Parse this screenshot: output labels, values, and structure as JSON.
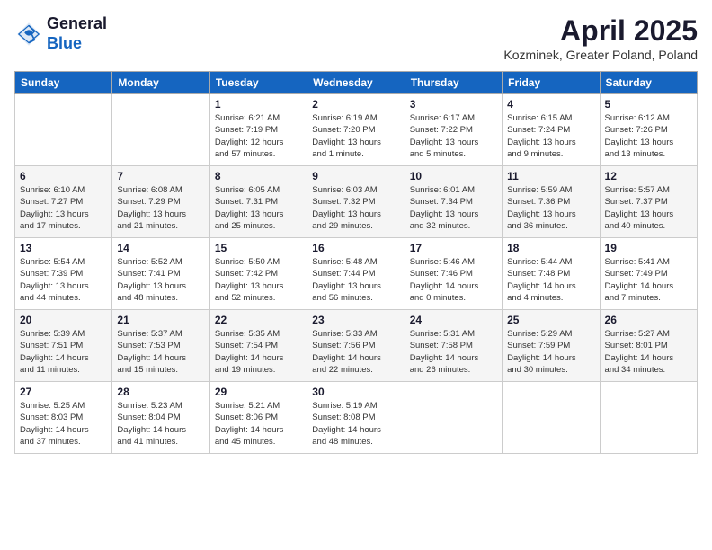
{
  "header": {
    "logo_general": "General",
    "logo_blue": "Blue",
    "month_title": "April 2025",
    "location": "Kozminek, Greater Poland, Poland"
  },
  "weekdays": [
    "Sunday",
    "Monday",
    "Tuesday",
    "Wednesday",
    "Thursday",
    "Friday",
    "Saturday"
  ],
  "weeks": [
    [
      {
        "day": "",
        "info": ""
      },
      {
        "day": "",
        "info": ""
      },
      {
        "day": "1",
        "info": "Sunrise: 6:21 AM\nSunset: 7:19 PM\nDaylight: 12 hours\nand 57 minutes."
      },
      {
        "day": "2",
        "info": "Sunrise: 6:19 AM\nSunset: 7:20 PM\nDaylight: 13 hours\nand 1 minute."
      },
      {
        "day": "3",
        "info": "Sunrise: 6:17 AM\nSunset: 7:22 PM\nDaylight: 13 hours\nand 5 minutes."
      },
      {
        "day": "4",
        "info": "Sunrise: 6:15 AM\nSunset: 7:24 PM\nDaylight: 13 hours\nand 9 minutes."
      },
      {
        "day": "5",
        "info": "Sunrise: 6:12 AM\nSunset: 7:26 PM\nDaylight: 13 hours\nand 13 minutes."
      }
    ],
    [
      {
        "day": "6",
        "info": "Sunrise: 6:10 AM\nSunset: 7:27 PM\nDaylight: 13 hours\nand 17 minutes."
      },
      {
        "day": "7",
        "info": "Sunrise: 6:08 AM\nSunset: 7:29 PM\nDaylight: 13 hours\nand 21 minutes."
      },
      {
        "day": "8",
        "info": "Sunrise: 6:05 AM\nSunset: 7:31 PM\nDaylight: 13 hours\nand 25 minutes."
      },
      {
        "day": "9",
        "info": "Sunrise: 6:03 AM\nSunset: 7:32 PM\nDaylight: 13 hours\nand 29 minutes."
      },
      {
        "day": "10",
        "info": "Sunrise: 6:01 AM\nSunset: 7:34 PM\nDaylight: 13 hours\nand 32 minutes."
      },
      {
        "day": "11",
        "info": "Sunrise: 5:59 AM\nSunset: 7:36 PM\nDaylight: 13 hours\nand 36 minutes."
      },
      {
        "day": "12",
        "info": "Sunrise: 5:57 AM\nSunset: 7:37 PM\nDaylight: 13 hours\nand 40 minutes."
      }
    ],
    [
      {
        "day": "13",
        "info": "Sunrise: 5:54 AM\nSunset: 7:39 PM\nDaylight: 13 hours\nand 44 minutes."
      },
      {
        "day": "14",
        "info": "Sunrise: 5:52 AM\nSunset: 7:41 PM\nDaylight: 13 hours\nand 48 minutes."
      },
      {
        "day": "15",
        "info": "Sunrise: 5:50 AM\nSunset: 7:42 PM\nDaylight: 13 hours\nand 52 minutes."
      },
      {
        "day": "16",
        "info": "Sunrise: 5:48 AM\nSunset: 7:44 PM\nDaylight: 13 hours\nand 56 minutes."
      },
      {
        "day": "17",
        "info": "Sunrise: 5:46 AM\nSunset: 7:46 PM\nDaylight: 14 hours\nand 0 minutes."
      },
      {
        "day": "18",
        "info": "Sunrise: 5:44 AM\nSunset: 7:48 PM\nDaylight: 14 hours\nand 4 minutes."
      },
      {
        "day": "19",
        "info": "Sunrise: 5:41 AM\nSunset: 7:49 PM\nDaylight: 14 hours\nand 7 minutes."
      }
    ],
    [
      {
        "day": "20",
        "info": "Sunrise: 5:39 AM\nSunset: 7:51 PM\nDaylight: 14 hours\nand 11 minutes."
      },
      {
        "day": "21",
        "info": "Sunrise: 5:37 AM\nSunset: 7:53 PM\nDaylight: 14 hours\nand 15 minutes."
      },
      {
        "day": "22",
        "info": "Sunrise: 5:35 AM\nSunset: 7:54 PM\nDaylight: 14 hours\nand 19 minutes."
      },
      {
        "day": "23",
        "info": "Sunrise: 5:33 AM\nSunset: 7:56 PM\nDaylight: 14 hours\nand 22 minutes."
      },
      {
        "day": "24",
        "info": "Sunrise: 5:31 AM\nSunset: 7:58 PM\nDaylight: 14 hours\nand 26 minutes."
      },
      {
        "day": "25",
        "info": "Sunrise: 5:29 AM\nSunset: 7:59 PM\nDaylight: 14 hours\nand 30 minutes."
      },
      {
        "day": "26",
        "info": "Sunrise: 5:27 AM\nSunset: 8:01 PM\nDaylight: 14 hours\nand 34 minutes."
      }
    ],
    [
      {
        "day": "27",
        "info": "Sunrise: 5:25 AM\nSunset: 8:03 PM\nDaylight: 14 hours\nand 37 minutes."
      },
      {
        "day": "28",
        "info": "Sunrise: 5:23 AM\nSunset: 8:04 PM\nDaylight: 14 hours\nand 41 minutes."
      },
      {
        "day": "29",
        "info": "Sunrise: 5:21 AM\nSunset: 8:06 PM\nDaylight: 14 hours\nand 45 minutes."
      },
      {
        "day": "30",
        "info": "Sunrise: 5:19 AM\nSunset: 8:08 PM\nDaylight: 14 hours\nand 48 minutes."
      },
      {
        "day": "",
        "info": ""
      },
      {
        "day": "",
        "info": ""
      },
      {
        "day": "",
        "info": ""
      }
    ]
  ]
}
